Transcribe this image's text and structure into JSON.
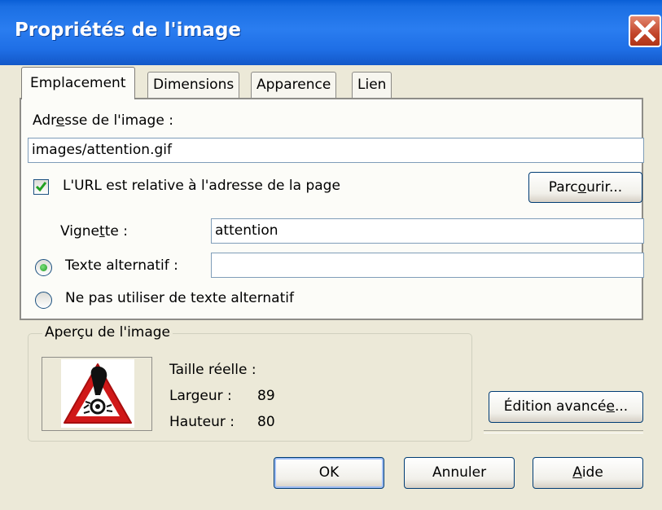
{
  "window": {
    "title": "Propriétés de l'image"
  },
  "tabs": [
    {
      "label": "Emplacement",
      "active": true
    },
    {
      "label": "Dimensions",
      "active": false
    },
    {
      "label": "Apparence",
      "active": false
    },
    {
      "label": "Lien",
      "active": false
    }
  ],
  "location": {
    "address_label_pre": "Adr",
    "address_label_mnemonic": "e",
    "address_label_post": "sse de l'image :",
    "address_value": "images/attention.gif",
    "relative_checkbox_label": "L'URL est relative à l'adresse de la page",
    "relative_checked": true,
    "browse_pre": "Parc",
    "browse_mnemonic": "o",
    "browse_post": "urir...",
    "tooltip_label_pre": "Vigne",
    "tooltip_label_mnemonic": "t",
    "tooltip_label_post": "te :",
    "tooltip_value": "attention",
    "alt_text_label": "Texte alternatif :",
    "alt_text_value": "",
    "no_alt_label": "Ne pas utiliser de texte alternatif",
    "selected_option": "alt_text"
  },
  "preview": {
    "group_label": "Aperçu de l'image",
    "actual_size_label": "Taille réelle :",
    "width_label": "Largeur :",
    "width_value": "89",
    "height_label": "Hauteur :",
    "height_value": "80",
    "icon": "warning-sign-icon"
  },
  "advanced": {
    "pre": "Édition avancé",
    "mnemonic": "e",
    "post": "..."
  },
  "buttons": {
    "ok": "OK",
    "cancel": "Annuler",
    "help_mnemonic": "A",
    "help_post": "ide"
  },
  "colors": {
    "titlebar": "#2a7df0",
    "dialog_bg": "#ece9d8",
    "close": "#c2452a",
    "check": "#21a121",
    "warning_red": "#d01818"
  }
}
